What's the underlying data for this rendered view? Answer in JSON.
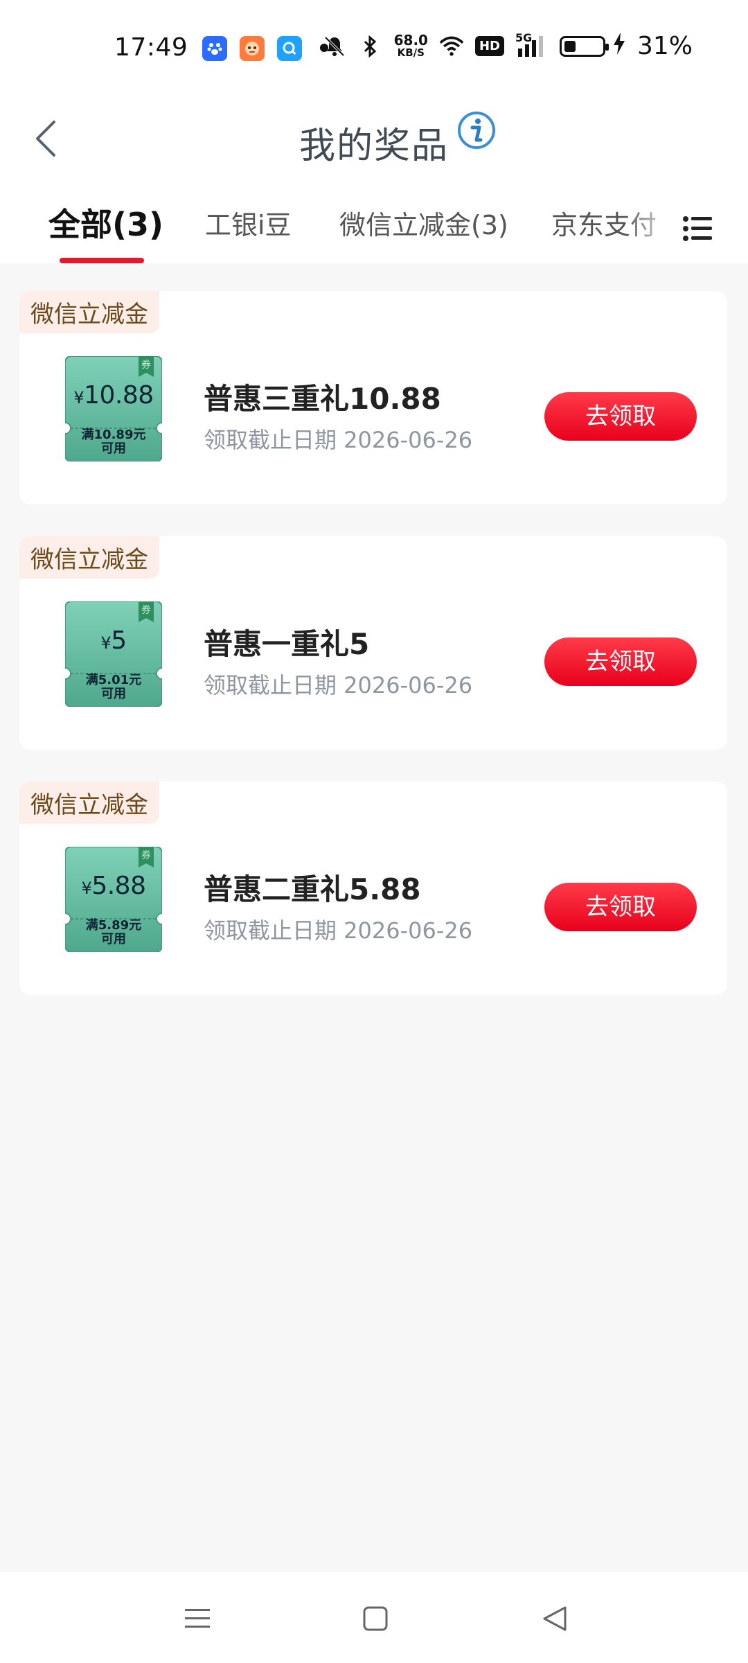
{
  "status_bar": {
    "time": "17:49",
    "speed_value": "68.0",
    "speed_unit": "KB/S",
    "hd_label": "HD",
    "network_label": "5G",
    "battery_percent": "31%",
    "battery_level": 0.31,
    "icons": [
      "baidu-app-icon",
      "mascot-app-icon",
      "search-app-icon",
      "mute-bell-icon",
      "bluetooth-icon",
      "wifi-icon",
      "signal-icon",
      "battery-icon",
      "charging-icon"
    ]
  },
  "header": {
    "title": "我的奖品"
  },
  "tabs": [
    {
      "label": "全部(3)",
      "active": true
    },
    {
      "label": "工银i豆",
      "active": false
    },
    {
      "label": "微信立减金(3)",
      "active": false
    },
    {
      "label": "京东支付",
      "active": false
    }
  ],
  "coupon_badge": "券",
  "cards": [
    {
      "tag": "微信立减金",
      "coupon_currency": "¥",
      "coupon_amount": "10.88",
      "coupon_condition_line1": "满10.89元",
      "coupon_condition_line2": "可用",
      "title": "普惠三重礼10.88",
      "deadline": "领取截止日期 2026-06-26",
      "button": "去领取"
    },
    {
      "tag": "微信立减金",
      "coupon_currency": "¥",
      "coupon_amount": "5",
      "coupon_condition_line1": "满5.01元",
      "coupon_condition_line2": "可用",
      "title": "普惠一重礼5",
      "deadline": "领取截止日期 2026-06-26",
      "button": "去领取"
    },
    {
      "tag": "微信立减金",
      "coupon_currency": "¥",
      "coupon_amount": "5.88",
      "coupon_condition_line1": "满5.89元",
      "coupon_condition_line2": "可用",
      "title": "普惠二重礼5.88",
      "deadline": "领取截止日期 2026-06-26",
      "button": "去领取"
    }
  ],
  "colors": {
    "accent_red": "#e8001c",
    "tab_underline": "#e11a2e",
    "coupon_green": "#5fb59b",
    "tag_bg": "#fdeeea",
    "tag_text": "#6b4a1a"
  }
}
